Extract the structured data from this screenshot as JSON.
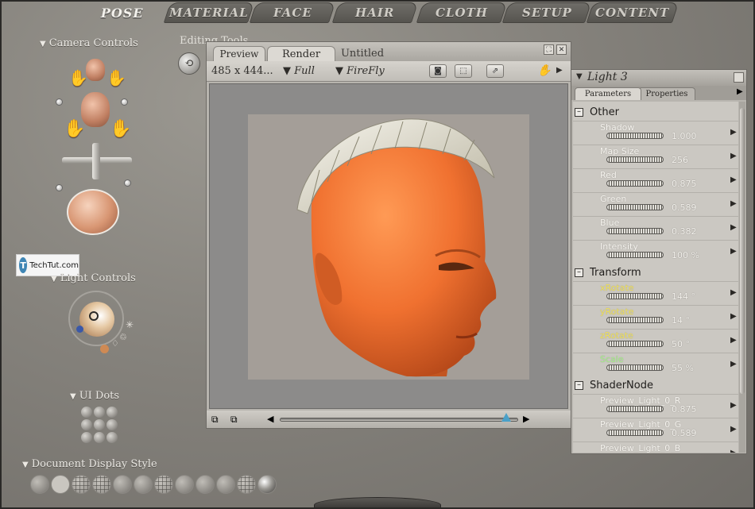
{
  "top_tabs": [
    "POSE",
    "MATERIAL",
    "FACE",
    "HAIR",
    "CLOTH",
    "SETUP",
    "CONTENT"
  ],
  "left_panel": {
    "camera_controls": "Camera Controls",
    "light_controls": "Light Controls",
    "ui_dots": "UI Dots",
    "document_display_style": "Document Display Style"
  },
  "watermark": {
    "logo": "T",
    "text": "TechTut.com"
  },
  "editing_tools": {
    "label": "Editing Tools"
  },
  "document": {
    "tabs": [
      "Preview",
      "Render",
      "Untitled"
    ],
    "size": "485 x 444...",
    "resolution": "Full",
    "renderer": "FireFly"
  },
  "parameters": {
    "title": "Light 3",
    "tabs": [
      "Parameters",
      "Properties"
    ],
    "groups": [
      {
        "name": "Other",
        "params": [
          {
            "label": "Shadow",
            "value": "1.000",
            "color": "#f7f5f0"
          },
          {
            "label": "Map Size",
            "value": "256",
            "color": "#f7f5f0"
          },
          {
            "label": "Red",
            "value": "0.875",
            "color": "#f7f5f0"
          },
          {
            "label": "Green",
            "value": "0.589",
            "color": "#f7f5f0"
          },
          {
            "label": "Blue",
            "value": "0.382",
            "color": "#f7f5f0"
          },
          {
            "label": "Intensity",
            "value": "100 %",
            "color": "#f7f5f0"
          }
        ]
      },
      {
        "name": "Transform",
        "params": [
          {
            "label": "xRotate",
            "value": "144 °",
            "color": "#f2e35c"
          },
          {
            "label": "yRotate",
            "value": "14 °",
            "color": "#f2e35c"
          },
          {
            "label": "zRotate",
            "value": "50 °",
            "color": "#f2e35c"
          },
          {
            "label": "Scale",
            "value": "55 %",
            "color": "#a8f08c"
          }
        ]
      },
      {
        "name": "ShaderNode",
        "params": [
          {
            "label": "Preview_Light_0_R",
            "value": "0.875",
            "color": "#f7f5f0"
          },
          {
            "label": "Preview_Light_0_G",
            "value": "0.589",
            "color": "#f7f5f0"
          },
          {
            "label": "Preview_Light_0_B",
            "value": "",
            "color": "#f7f5f0"
          }
        ]
      }
    ]
  },
  "timeline": {
    "frame_fraction": 0.95
  }
}
